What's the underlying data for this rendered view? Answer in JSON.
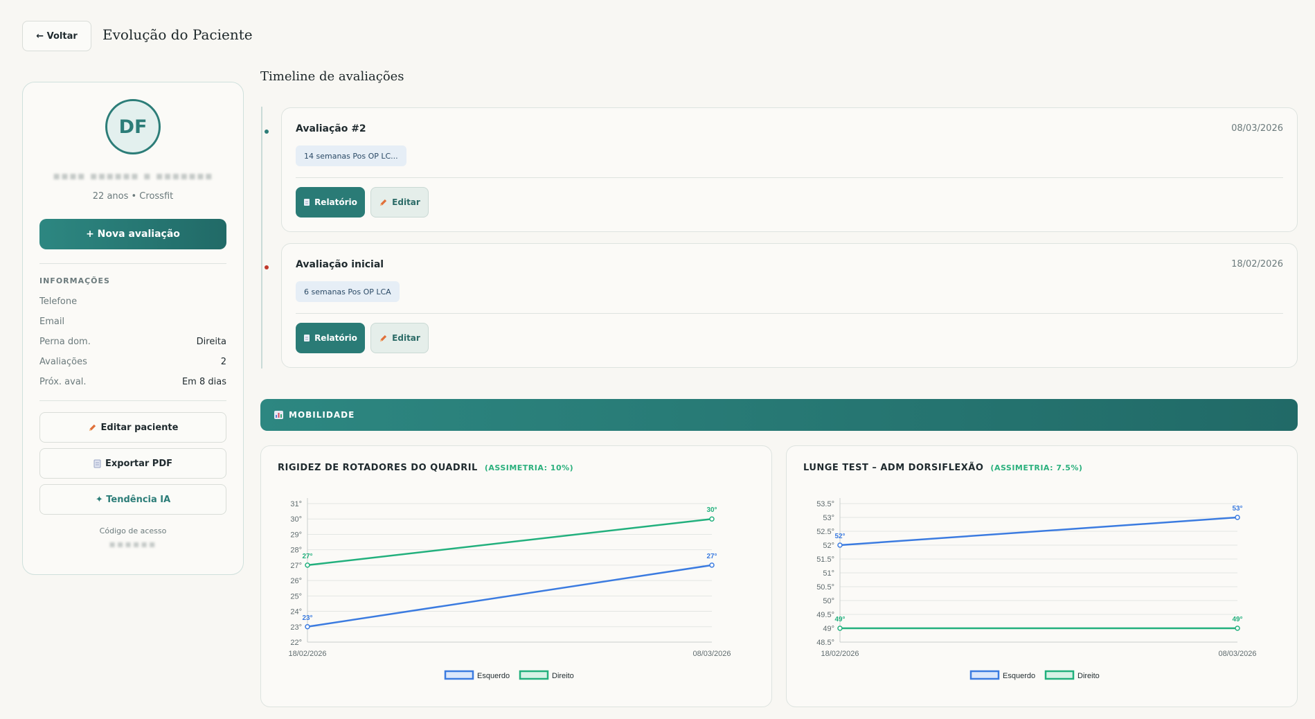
{
  "header": {
    "back_label": "← Voltar",
    "title": "Evolução do Paciente"
  },
  "sidebar": {
    "avatar_initials": "DF",
    "patient_name": "▪▪▪▪ ▪▪▪▪▪▪ ▪ ▪▪▪▪▪▪▪",
    "patient_meta": "22 anos • Crossfit",
    "new_eval_label": "+ Nova avaliação",
    "info_heading": "INFORMAÇÕES",
    "info": [
      {
        "label": "Telefone",
        "value": ""
      },
      {
        "label": "Email",
        "value": ""
      },
      {
        "label": "Perna dom.",
        "value": "Direita"
      },
      {
        "label": "Avaliações",
        "value": "2"
      },
      {
        "label": "Próx. aval.",
        "value": "Em 8 dias"
      }
    ],
    "edit_patient_label": "Editar paciente",
    "export_pdf_label": "Exportar PDF",
    "trend_ai_label": "✦ Tendência IA",
    "access_code_label": "Código de acesso",
    "access_code_value": "▪▪▪▪▪▪"
  },
  "timeline": {
    "title": "Timeline de avaliações",
    "evaluations": [
      {
        "title": "Avaliação #2",
        "date": "08/03/2026",
        "tag": "14 semanas Pos OP LC...",
        "report_label": "Relatório",
        "edit_label": "Editar",
        "dot_color": "#2c7d78"
      },
      {
        "title": "Avaliação inicial",
        "date": "18/02/2026",
        "tag": "6 semanas Pos OP LCA",
        "report_label": "Relatório",
        "edit_label": "Editar",
        "dot_color": "#c0392b"
      }
    ]
  },
  "mobility": {
    "label": "MOBILIDADE"
  },
  "colors": {
    "accent": "#2a7b76",
    "left_series": "#3b7be0",
    "right_series": "#22b07d"
  },
  "chart_data": [
    {
      "type": "line",
      "title": "RIGIDEZ DE ROTADORES DO QUADRIL",
      "asymmetry": "(ASSIMETRIA: 10%)",
      "x": [
        "18/02/2026",
        "08/03/2026"
      ],
      "ylim": [
        22,
        31
      ],
      "yticks": [
        "22°",
        "23°",
        "24°",
        "25°",
        "26°",
        "27°",
        "28°",
        "29°",
        "30°",
        "31°"
      ],
      "ytick_values": [
        22,
        23,
        24,
        25,
        26,
        27,
        28,
        29,
        30,
        31
      ],
      "series": [
        {
          "name": "Esquerdo",
          "values": [
            23,
            27
          ],
          "labels": [
            "23°",
            "27°"
          ]
        },
        {
          "name": "Direito",
          "values": [
            27,
            30
          ],
          "labels": [
            "27°",
            "30°"
          ]
        }
      ],
      "grid": true,
      "legend": "bottom"
    },
    {
      "type": "line",
      "title": "LUNGE TEST – ADM DORSIFLEXÃO",
      "asymmetry": "(ASSIMETRIA: 7.5%)",
      "x": [
        "18/02/2026",
        "08/03/2026"
      ],
      "ylim": [
        48.5,
        53.5
      ],
      "yticks": [
        "48.5°",
        "49°",
        "49.5°",
        "50°",
        "50.5°",
        "51°",
        "51.5°",
        "52°",
        "52.5°",
        "53°",
        "53.5°"
      ],
      "ytick_values": [
        48.5,
        49,
        49.5,
        50,
        50.5,
        51,
        51.5,
        52,
        52.5,
        53,
        53.5
      ],
      "series": [
        {
          "name": "Esquerdo",
          "values": [
            52,
            53
          ],
          "labels": [
            "52°",
            "53°"
          ]
        },
        {
          "name": "Direito",
          "values": [
            49,
            49
          ],
          "labels": [
            "49°",
            "49°"
          ]
        }
      ],
      "grid": true,
      "legend": "bottom"
    }
  ]
}
